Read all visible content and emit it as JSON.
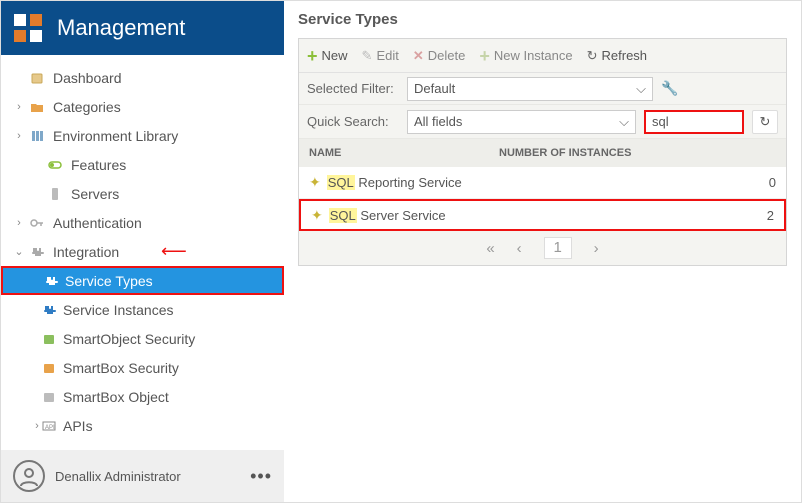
{
  "header": {
    "title": "Management"
  },
  "nav": {
    "items": [
      {
        "label": "Dashboard"
      },
      {
        "label": "Categories"
      },
      {
        "label": "Environment Library"
      },
      {
        "label": "Features"
      },
      {
        "label": "Servers"
      },
      {
        "label": "Authentication"
      },
      {
        "label": "Integration"
      },
      {
        "label": "Service Types"
      },
      {
        "label": "Service Instances"
      },
      {
        "label": "SmartObject Security"
      },
      {
        "label": "SmartBox Security"
      },
      {
        "label": "SmartBox Object"
      },
      {
        "label": "APIs"
      }
    ]
  },
  "user": {
    "name": "Denallix Administrator"
  },
  "page": {
    "title": "Service Types"
  },
  "toolbar": {
    "new": "New",
    "edit": "Edit",
    "delete": "Delete",
    "newInstance": "New Instance",
    "refresh": "Refresh"
  },
  "filter": {
    "label": "Selected Filter:",
    "value": "Default"
  },
  "search": {
    "label": "Quick Search:",
    "fieldValue": "All fields",
    "query": "sql"
  },
  "grid": {
    "headers": {
      "name": "NAME",
      "instances": "NUMBER OF INSTANCES"
    },
    "rows": [
      {
        "match": "SQL",
        "rest": " Reporting Service",
        "count": "0"
      },
      {
        "match": "SQL",
        "rest": " Server Service",
        "count": "2"
      }
    ]
  },
  "pager": {
    "page": "1"
  }
}
